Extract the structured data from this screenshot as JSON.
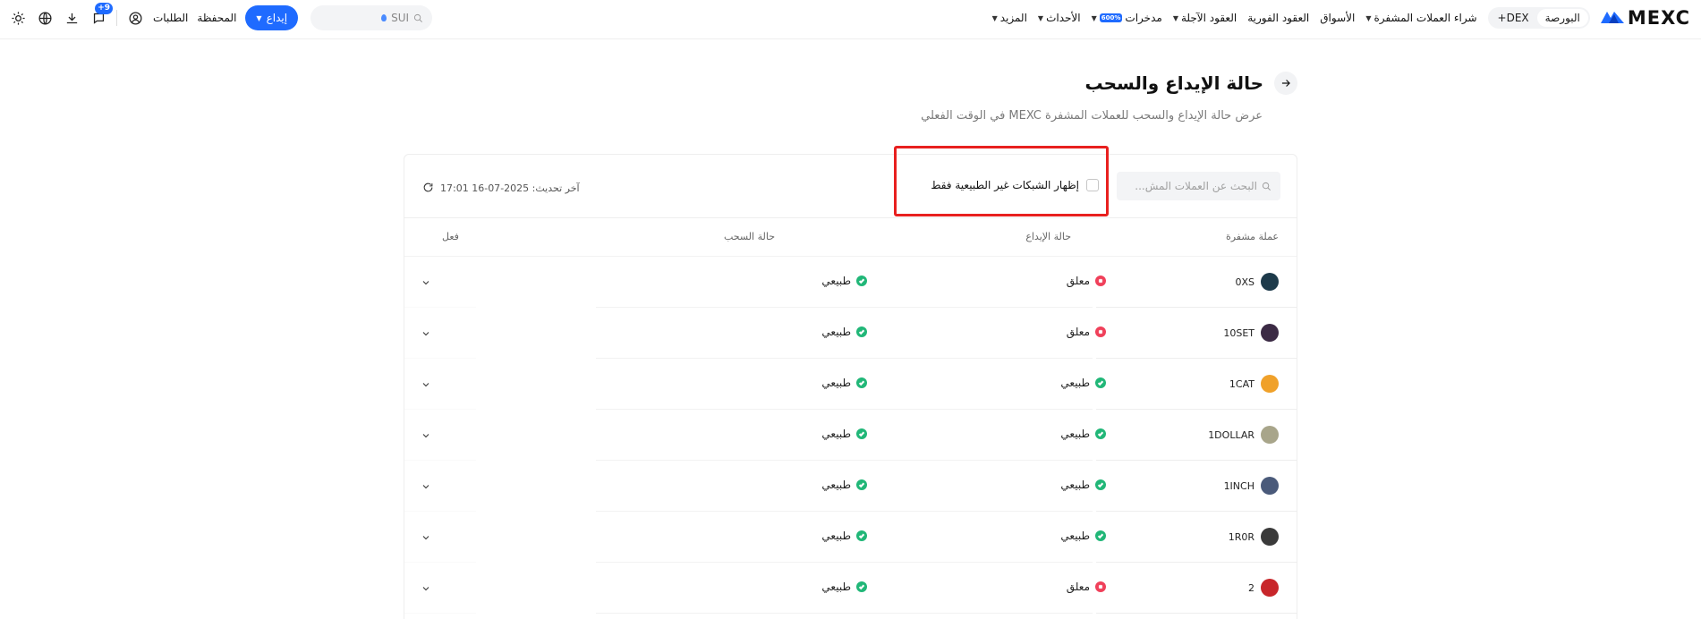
{
  "topnav": {
    "brand": "MEXC",
    "exchange_toggle": [
      "البورصة",
      "DEX+"
    ],
    "menu": [
      {
        "label": "شراء العملات المشفرة",
        "dropdown": true
      },
      {
        "label": "الأسواق",
        "dropdown": false
      },
      {
        "label": "العقود الفورية",
        "dropdown": false
      },
      {
        "label": "العقود الآجلة",
        "dropdown": true
      },
      {
        "label": "مدخرات",
        "dropdown": true,
        "badge": "600%"
      },
      {
        "label": "الأحداث",
        "dropdown": true
      },
      {
        "label": "المزيد",
        "dropdown": true
      }
    ],
    "search_value": "SUI",
    "deposit_label": "إيداع",
    "wallet_label": "المحفظة",
    "orders_label": "الطلبات",
    "notification_count": "+9"
  },
  "page": {
    "title": "حالة الإيداع والسحب",
    "subtitle": "عرض حالة الإيداع والسحب للعملات المشفرة MEXC في الوقت الفعلي"
  },
  "toolbar": {
    "search_placeholder": "البحث عن العملات المش...",
    "filter_label": "إظهار الشبكات غير الطبيعية فقط",
    "last_update": "آخر تحديث: 2025-07-16 17:01"
  },
  "table": {
    "headers": {
      "coin": "عملة مشفرة",
      "deposit": "حالة الإيداع",
      "withdraw": "حالة السحب",
      "action": "فعل"
    },
    "rows": [
      {
        "coin": "0XS",
        "deposit": "معلق",
        "deposit_ok": false,
        "withdraw": "طبيعي",
        "withdraw_ok": true,
        "logo_color": "#1d3a4a"
      },
      {
        "coin": "10SET",
        "deposit": "معلق",
        "deposit_ok": false,
        "withdraw": "طبيعي",
        "withdraw_ok": true,
        "logo_color": "#3b2a44"
      },
      {
        "coin": "1CAT",
        "deposit": "طبيعي",
        "deposit_ok": true,
        "withdraw": "طبيعي",
        "withdraw_ok": true,
        "logo_color": "#f0a12a"
      },
      {
        "coin": "1DOLLAR",
        "deposit": "طبيعي",
        "deposit_ok": true,
        "withdraw": "طبيعي",
        "withdraw_ok": true,
        "logo_color": "#a8a58a"
      },
      {
        "coin": "1INCH",
        "deposit": "طبيعي",
        "deposit_ok": true,
        "withdraw": "طبيعي",
        "withdraw_ok": true,
        "logo_color": "#4a5a7a"
      },
      {
        "coin": "1R0R",
        "deposit": "طبيعي",
        "deposit_ok": true,
        "withdraw": "طبيعي",
        "withdraw_ok": true,
        "logo_color": "#3a3a3a"
      },
      {
        "coin": "2",
        "deposit": "معلق",
        "deposit_ok": false,
        "withdraw": "طبيعي",
        "withdraw_ok": true,
        "logo_color": "#c8262a"
      }
    ]
  },
  "colors": {
    "accent": "#1f6bff",
    "ok": "#21b778",
    "bad": "#f0405a",
    "highlight": "#e8201f"
  }
}
